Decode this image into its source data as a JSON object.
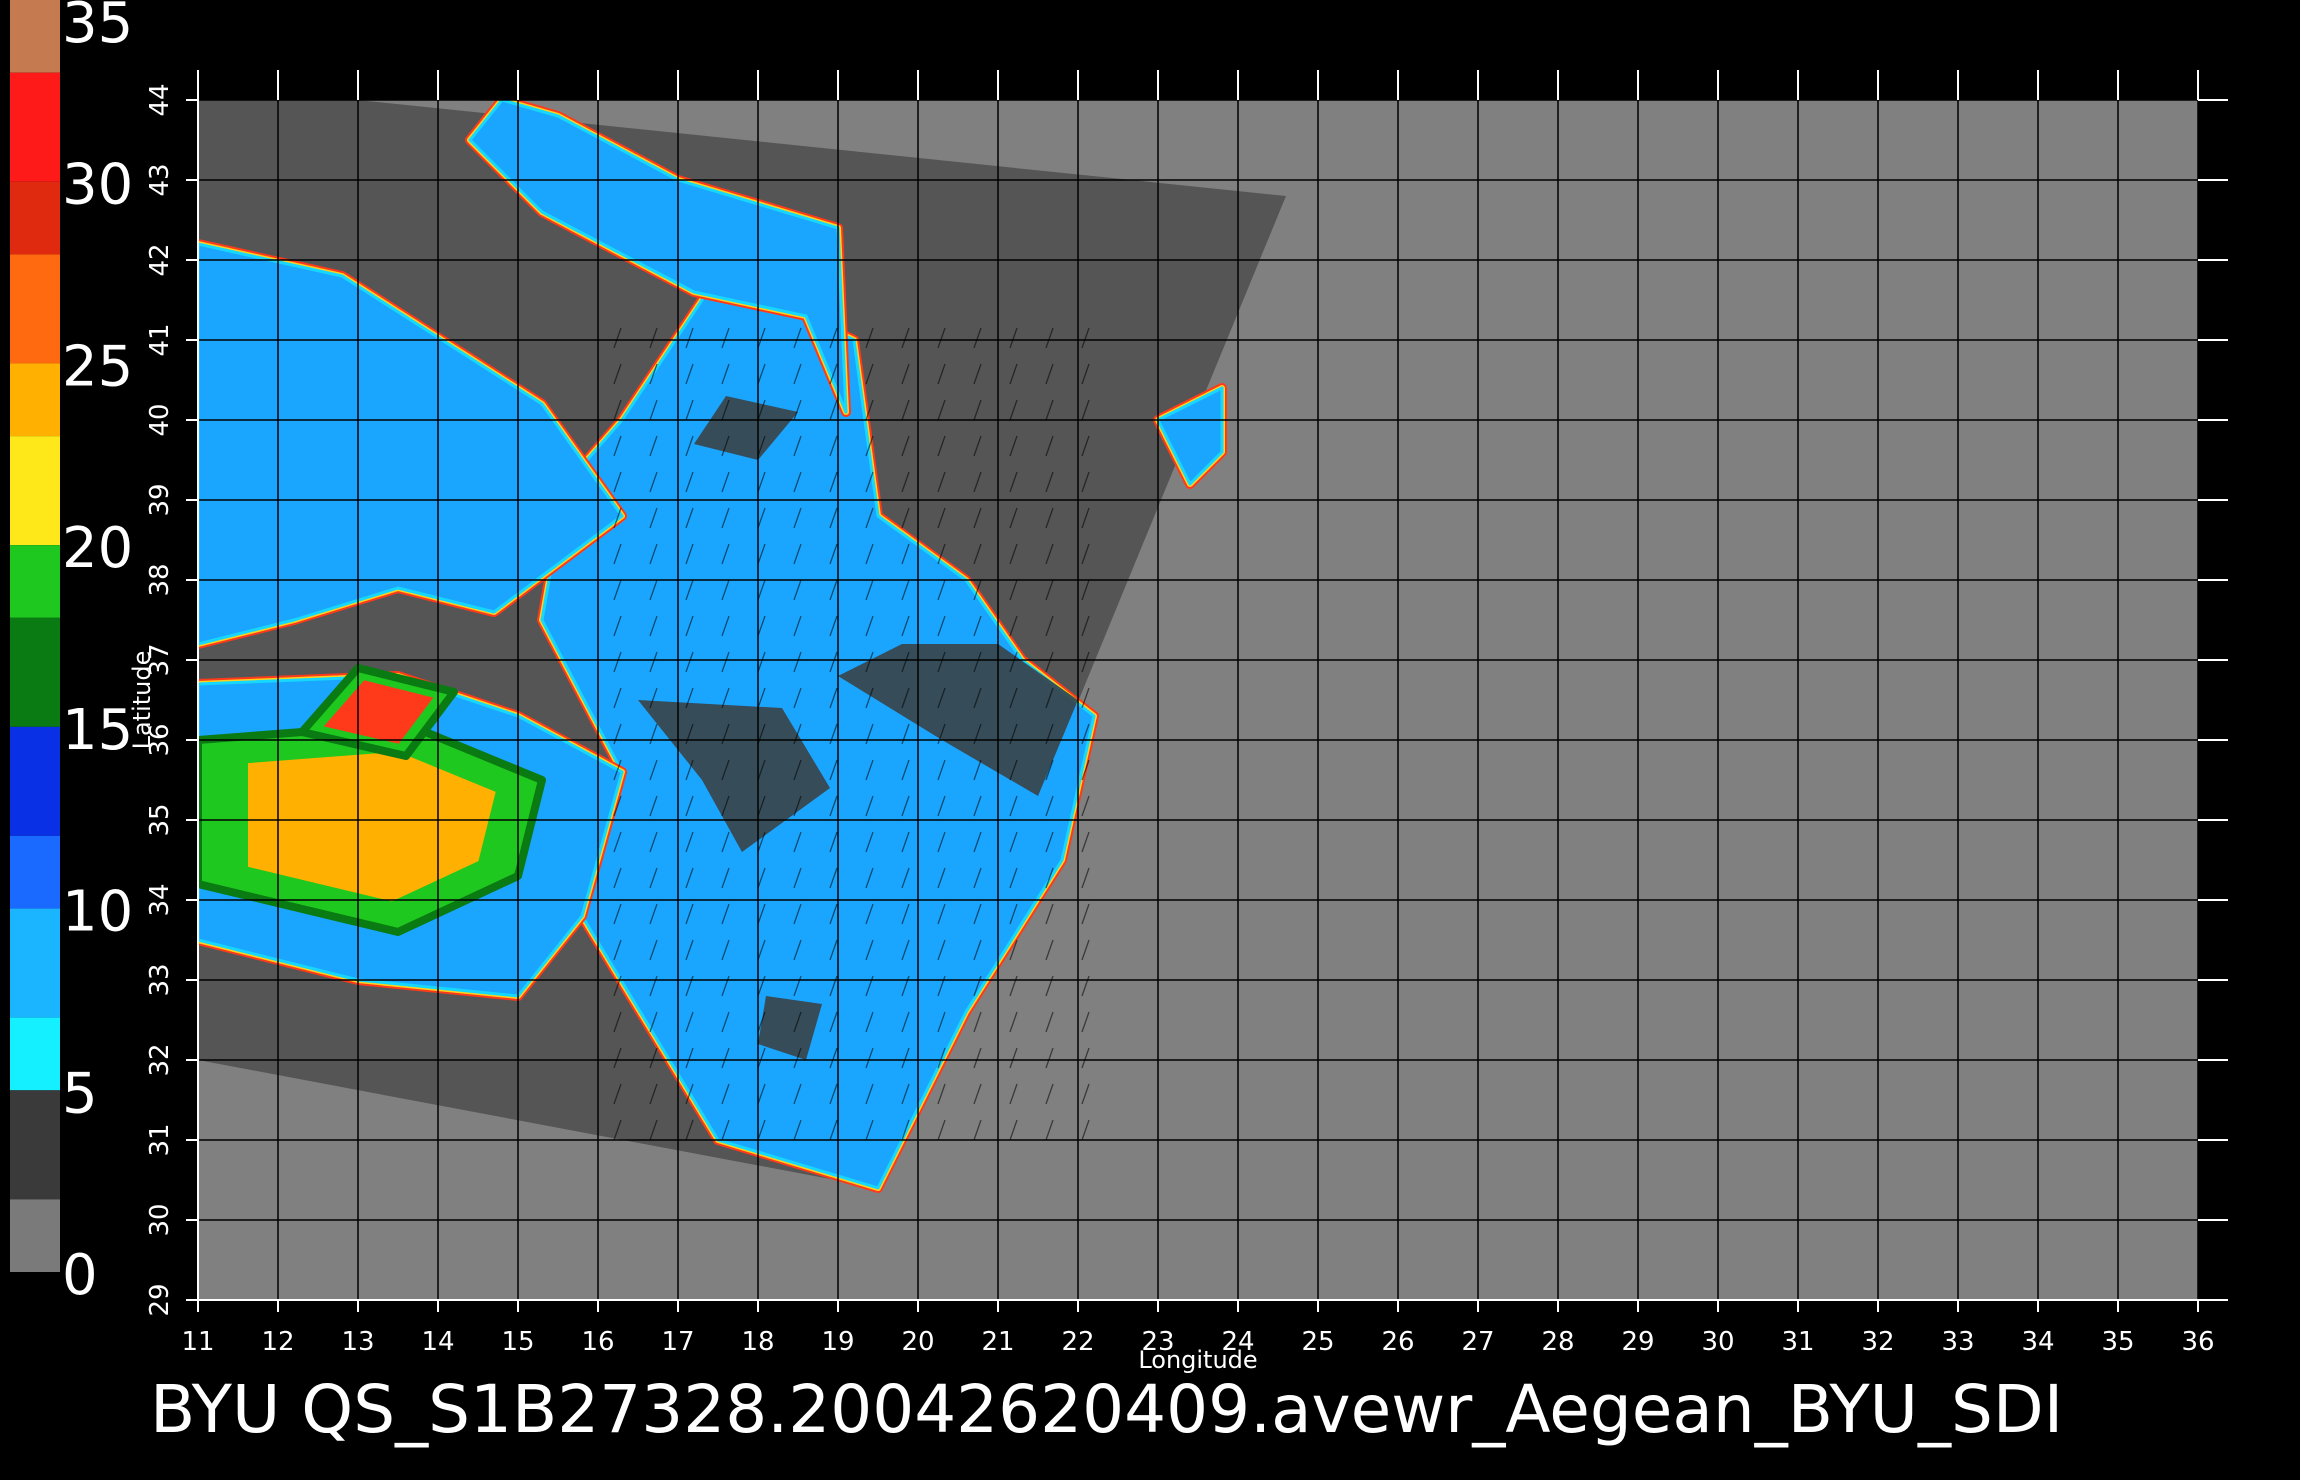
{
  "colorbar": {
    "labels": [
      "35",
      "30",
      "25",
      "20",
      "15",
      "10",
      "5",
      "0"
    ],
    "bands": [
      {
        "from": 33,
        "to": 35,
        "color": "#c57a4f"
      },
      {
        "from": 30,
        "to": 33,
        "color": "#ff1a1a"
      },
      {
        "from": 28,
        "to": 30,
        "color": "#e02a10"
      },
      {
        "from": 25,
        "to": 28,
        "color": "#ff6a10"
      },
      {
        "from": 23,
        "to": 25,
        "color": "#ffb000"
      },
      {
        "from": 20,
        "to": 23,
        "color": "#ffe81a"
      },
      {
        "from": 18,
        "to": 20,
        "color": "#1ec81e"
      },
      {
        "from": 15,
        "to": 18,
        "color": "#0a7a12"
      },
      {
        "from": 12,
        "to": 15,
        "color": "#0a30e6"
      },
      {
        "from": 10,
        "to": 12,
        "color": "#1a6aff"
      },
      {
        "from": 7,
        "to": 10,
        "color": "#1ab4ff"
      },
      {
        "from": 5,
        "to": 7,
        "color": "#14f0ff"
      },
      {
        "from": 2,
        "to": 5,
        "color": "#3a3a3a"
      },
      {
        "from": 0,
        "to": 2,
        "color": "#7a7a7a"
      }
    ]
  },
  "map": {
    "lon_range": [
      11,
      36
    ],
    "lat_range": [
      29,
      44
    ],
    "lon_ticks": [
      "11",
      "12",
      "13",
      "14",
      "15",
      "16",
      "17",
      "18",
      "19",
      "20",
      "21",
      "22",
      "23",
      "24",
      "25",
      "26",
      "27",
      "28",
      "29",
      "30",
      "31",
      "32",
      "33",
      "34",
      "35",
      "36"
    ],
    "lat_ticks": [
      "29",
      "30",
      "31",
      "32",
      "33",
      "34",
      "35",
      "36",
      "37",
      "38",
      "39",
      "40",
      "41",
      "42",
      "43",
      "44"
    ],
    "xlabel": "Longitude",
    "ylabel": "Latitude",
    "background_color": "#808080",
    "swath_color": "#555555",
    "grid_color": "#000000",
    "swath_outline": [
      [
        11,
        32.0
      ],
      [
        19.5,
        30.4
      ],
      [
        24.6,
        42.8
      ],
      [
        13.0,
        44.0
      ],
      [
        11,
        44.0
      ]
    ],
    "ocean_regions": [
      {
        "name": "aegean",
        "points": [
          [
            16.3,
            40.0
          ],
          [
            17.5,
            41.8
          ],
          [
            19.2,
            41.0
          ],
          [
            19.5,
            38.8
          ],
          [
            20.6,
            38.0
          ],
          [
            21.3,
            37.0
          ],
          [
            22.2,
            36.3
          ],
          [
            21.8,
            34.5
          ],
          [
            20.6,
            32.6
          ],
          [
            19.5,
            30.4
          ],
          [
            17.5,
            31.0
          ],
          [
            15.8,
            33.8
          ],
          [
            16.3,
            35.6
          ],
          [
            15.3,
            37.5
          ],
          [
            15.6,
            39.2
          ]
        ]
      },
      {
        "name": "north-arm",
        "points": [
          [
            14.4,
            43.5
          ],
          [
            15.3,
            42.6
          ],
          [
            17.2,
            41.6
          ],
          [
            18.6,
            41.3
          ],
          [
            19.1,
            40.1
          ],
          [
            19.0,
            42.4
          ],
          [
            17.0,
            43.0
          ],
          [
            15.5,
            43.8
          ],
          [
            14.8,
            44.0
          ]
        ]
      },
      {
        "name": "west-upper",
        "points": [
          [
            11,
            42.2
          ],
          [
            12.8,
            41.8
          ],
          [
            15.3,
            40.2
          ],
          [
            16.3,
            38.8
          ],
          [
            14.7,
            37.6
          ],
          [
            13.5,
            37.9
          ],
          [
            12.2,
            37.5
          ],
          [
            11,
            37.2
          ]
        ]
      },
      {
        "name": "west-lower",
        "points": [
          [
            11,
            36.7
          ],
          [
            13.5,
            36.8
          ],
          [
            15.0,
            36.3
          ],
          [
            16.3,
            35.6
          ],
          [
            15.8,
            33.8
          ],
          [
            15.0,
            32.8
          ],
          [
            13.0,
            33.0
          ],
          [
            11,
            33.5
          ]
        ]
      },
      {
        "name": "east-patch",
        "points": [
          [
            23.8,
            40.4
          ],
          [
            23.0,
            40.0
          ],
          [
            23.4,
            39.2
          ],
          [
            23.8,
            39.6
          ]
        ]
      }
    ],
    "high_wind_regions": [
      {
        "points": [
          [
            11,
            34.2
          ],
          [
            13.5,
            33.6
          ],
          [
            15.0,
            34.3
          ],
          [
            15.3,
            35.5
          ],
          [
            13.6,
            36.2
          ],
          [
            11,
            36.0
          ]
        ]
      },
      {
        "points": [
          [
            12.3,
            36.1
          ],
          [
            13.6,
            35.8
          ],
          [
            14.2,
            36.6
          ],
          [
            13.0,
            36.9
          ]
        ]
      }
    ],
    "land_regions": [
      {
        "points": [
          [
            16.5,
            36.5
          ],
          [
            17.3,
            35.5
          ],
          [
            17.8,
            34.6
          ],
          [
            18.9,
            35.4
          ],
          [
            18.3,
            36.4
          ]
        ]
      },
      {
        "points": [
          [
            19.0,
            36.8
          ],
          [
            20.3,
            36.0
          ],
          [
            21.5,
            35.3
          ],
          [
            22.0,
            36.5
          ],
          [
            21.0,
            37.2
          ],
          [
            19.8,
            37.2
          ]
        ]
      },
      {
        "points": [
          [
            18.0,
            32.2
          ],
          [
            18.6,
            32.0
          ],
          [
            18.8,
            32.7
          ],
          [
            18.1,
            32.8
          ]
        ]
      },
      {
        "points": [
          [
            17.2,
            39.7
          ],
          [
            18.0,
            39.5
          ],
          [
            18.5,
            40.1
          ],
          [
            17.6,
            40.3
          ]
        ]
      }
    ]
  },
  "caption": "BYU  QS_S1B27328.20042620409.avewr_Aegean_BYU_SDI"
}
